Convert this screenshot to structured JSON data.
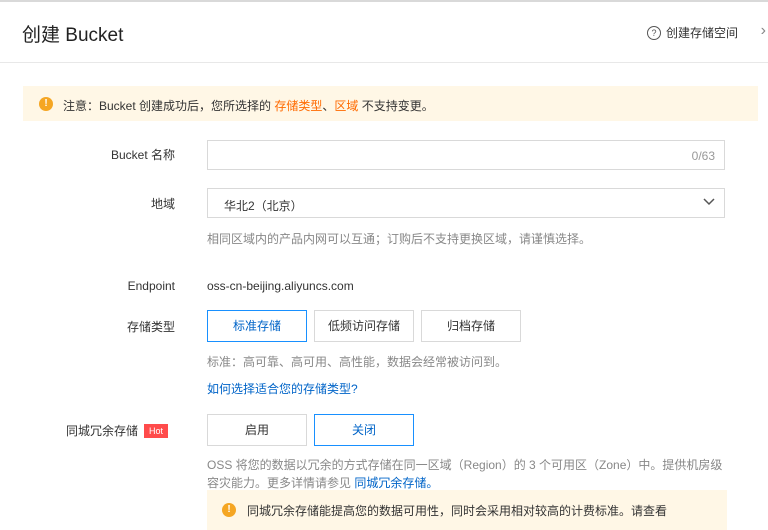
{
  "header": {
    "title": "创建 Bucket",
    "help_label": "创建存储空间",
    "help_icon": "question-circle-icon",
    "close_icon": "chevron-right-icon"
  },
  "notice": {
    "prefix": "注意：Bucket 创建成功后，您所选择的 ",
    "highlight1": "存储类型",
    "sep": "、",
    "highlight2": "区域",
    "suffix": " 不支持变更。",
    "icon": "warning-icon"
  },
  "form": {
    "bucket_name": {
      "label": "Bucket 名称",
      "value": "",
      "counter": "0/63"
    },
    "region": {
      "label": "地域",
      "selected": "华北2（北京）",
      "hint": "相同区域内的产品内网可以互通；订购后不支持更换区域，请谨慎选择。"
    },
    "endpoint": {
      "label": "Endpoint",
      "value": "oss-cn-beijing.aliyuncs.com"
    },
    "storage_type": {
      "label": "存储类型",
      "options": [
        "标准存储",
        "低频访问存储",
        "归档存储"
      ],
      "selected": "标准存储",
      "hint": "标准：高可靠、高可用、高性能，数据会经常被访问到。",
      "link": "如何选择适合您的存储类型?"
    },
    "redundancy": {
      "label": "同城冗余存储",
      "badge": "Hot",
      "options": [
        "启用",
        "关闭"
      ],
      "selected": "关闭",
      "desc_line1": "OSS 将您的数据以冗余的方式存储在同一区域（Region）的 3 个可用区（Zone）中。提供机房级",
      "desc_line2": "容灾能力。更多详情请参见 ",
      "desc_link": "同城冗余存储。",
      "warning": "同城冗余存储能提高您的数据可用性，同时会采用相对较高的计费标准。请查看"
    }
  },
  "colors": {
    "accent": "#0064c8",
    "highlight": "#ff6a00",
    "warning_bg": "#fff7e6",
    "hot_badge": "#ff4b4b"
  }
}
